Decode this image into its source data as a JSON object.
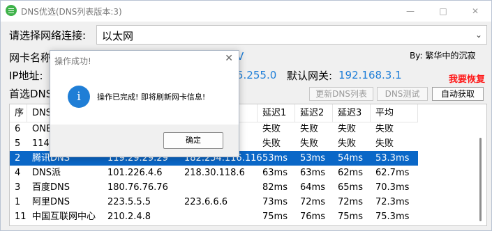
{
  "window": {
    "title": "DNS优选(DNS列表版本:3)",
    "minimize": "—",
    "maximize": "□",
    "close": "✕"
  },
  "connection": {
    "label": "请选择网络连接:",
    "value": "以太网"
  },
  "adapter": {
    "label": "网卡名称",
    "value_fragment": "V"
  },
  "ip": {
    "label": "IP地址:",
    "mask_fragment": "5.255.0"
  },
  "gateway": {
    "label": "默认网关:",
    "value": "192.168.3.1"
  },
  "credit": "By: 繁华中的沉寂",
  "restore": "我要恢复",
  "preferred": {
    "label": "首选DNS"
  },
  "buttons": {
    "update_list": "更新DNS列表",
    "test": "DNS测试",
    "auto": "自动获取"
  },
  "table": {
    "headers": [
      "序",
      "DNS",
      "",
      "",
      "延迟1",
      "延迟2",
      "延迟3",
      "平均"
    ],
    "rows": [
      [
        "6",
        "ONE",
        "",
        "",
        "失败",
        "失败",
        "失败",
        "失败"
      ],
      [
        "5",
        "114D",
        "",
        "5",
        "失败",
        "失败",
        "失败",
        "失败"
      ],
      [
        "2",
        "腾讯DNS",
        "119.29.29.29",
        "182.254.116.116",
        "53ms",
        "53ms",
        "54ms",
        "53.3ms"
      ],
      [
        "4",
        "DNS派",
        "101.226.4.6",
        "218.30.118.6",
        "63ms",
        "63ms",
        "62ms",
        "62.7ms"
      ],
      [
        "3",
        "百度DNS",
        "180.76.76.76",
        "",
        "82ms",
        "64ms",
        "65ms",
        "70.3ms"
      ],
      [
        "1",
        "阿里DNS",
        "223.5.5.5",
        "223.6.6.6",
        "73ms",
        "72ms",
        "72ms",
        "72.3ms"
      ],
      [
        "11",
        "中国互联网中心",
        "210.2.4.8",
        "",
        "75ms",
        "76ms",
        "75ms",
        "75.3ms"
      ]
    ]
  },
  "dialog": {
    "title": "操作成功!",
    "message": "操作已完成! 即将刷新网卡信息!",
    "ok": "确定",
    "close": "✕",
    "icon": "i"
  }
}
